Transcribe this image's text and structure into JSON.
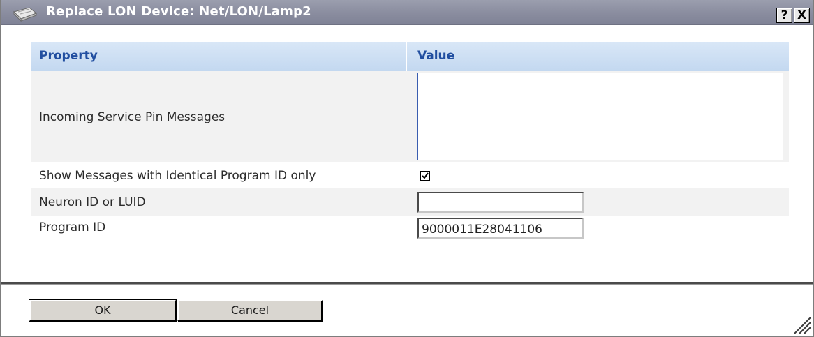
{
  "window": {
    "title": "Replace LON Device: Net/LON/Lamp2",
    "help_label": "?",
    "close_label": "X"
  },
  "table": {
    "headers": {
      "property": "Property",
      "value": "Value"
    },
    "rows": {
      "incoming": {
        "label": "Incoming Service Pin Messages",
        "value": ""
      },
      "show_identical": {
        "label": "Show Messages with Identical Program ID only",
        "checked": true
      },
      "neuron": {
        "label": "Neuron ID or LUID",
        "value": ""
      },
      "program": {
        "label": "Program ID",
        "value": "9000011E28041106"
      }
    }
  },
  "buttons": {
    "ok": "OK",
    "cancel": "Cancel"
  },
  "colors": {
    "titlebar": "#8b8ea0",
    "header_bg": "#c9dcf2",
    "header_text": "#214ea0",
    "textarea_border": "#3a5db0"
  },
  "icons": {
    "window_icon": "notepad-icon",
    "checkbox": "checkmark-icon",
    "resize": "resize-grip-icon"
  }
}
